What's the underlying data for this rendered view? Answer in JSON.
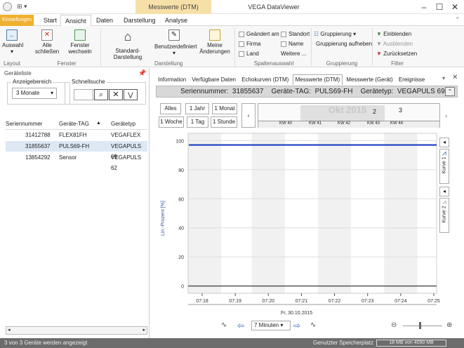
{
  "title": {
    "context_tab": "Messwerte (DTM)",
    "app_title": "VEGA DataViewer"
  },
  "menu": {
    "tabs": [
      "Einstellungen",
      "Start",
      "Ansicht",
      "Daten",
      "Darstellung",
      "Analyse"
    ]
  },
  "ribbon": {
    "auswahl": "Auswahl",
    "alle_schliessen": "Alle schließen",
    "fenster_wechseln": "Fenster wechseln",
    "standard_darstellung": "Standard-Darstellung",
    "benutzerdefiniert": "Benutzerdefiniert",
    "meine_aenderungen": "Meine Änderungen",
    "geaendert_am": "Geändert am",
    "standort": "Standort",
    "firma": "Firma",
    "name": "Name",
    "land": "Land",
    "weitere": "Weitere ...",
    "gruppierung": "Gruppierung",
    "gruppierung_aufheben": "Gruppierung aufheben",
    "einblenden": "Einblenden",
    "ausblenden": "Ausblenden",
    "zuruecksetzen": "Zurücksetzen",
    "group_layout": "Layout",
    "group_fenster": "Fenster",
    "group_darstellung": "Darstellung",
    "group_spaltenauswahl": "Spaltenauswahl",
    "group_gruppierung": "Gruppierung",
    "group_filter": "Filter"
  },
  "left": {
    "title": "Geräteliste",
    "anzeigebereich": "Anzeigebereich",
    "schnellsuche": "Schnellsuche",
    "range_value": "3 Monate",
    "columns": [
      "Seriennummer",
      "Geräte-TAG",
      "Gerätetyp"
    ],
    "rows": [
      [
        "31412788",
        "FLEX81FH",
        "VEGAFLEX 81"
      ],
      [
        "31855637",
        "PULS69-FH",
        "VEGAPULS 69"
      ],
      [
        "13854292",
        "Sensor",
        "VEGAPULS 62"
      ]
    ]
  },
  "panel": {
    "tabs": [
      "Information",
      "Verfügbare Daten",
      "Echokurven (DTM)",
      "Messwerte (DTM)",
      "Messwerte (Gerät)",
      "Ereignisse"
    ],
    "header": "Seriennummer:  31855637    Geräte-TAG:  PULS69-FH    Gerätetyp:  VEGAPULS 69",
    "range_btns": [
      "Alles",
      "1 Jahr",
      "1 Monat",
      "1 Woche",
      "1 Tag",
      "1 Stunde"
    ],
    "overview_month": "Okt 2015",
    "overview_weeks": [
      "KW 40",
      "KW 41",
      "KW 42",
      "KW 43",
      "KW 44"
    ],
    "overview_nums": [
      "2",
      "3"
    ],
    "step": "7 Minuten",
    "kurve1": "Kurve 1",
    "kurve2": "Kurve 2",
    "date_label": "Fr, 30.10.2015"
  },
  "chart_data": {
    "type": "line",
    "ylabel": "Lin.-Prozent [%]",
    "yticks": [
      0,
      20,
      40,
      60,
      80,
      100
    ],
    "ylim": [
      -5,
      105
    ],
    "xticks": [
      "07:18",
      "07:19",
      "07:20",
      "07:21",
      "07:22",
      "07:23",
      "07:24",
      "07:25"
    ],
    "series": [
      {
        "values": [
          97,
          97,
          97,
          97,
          97,
          97,
          97,
          97
        ]
      }
    ]
  },
  "status": {
    "left": "3 von 3 Geräte werden angezeigt",
    "right_label": "Genutzter Speicherplatz",
    "memory": "18 MB von 4090 MB"
  }
}
